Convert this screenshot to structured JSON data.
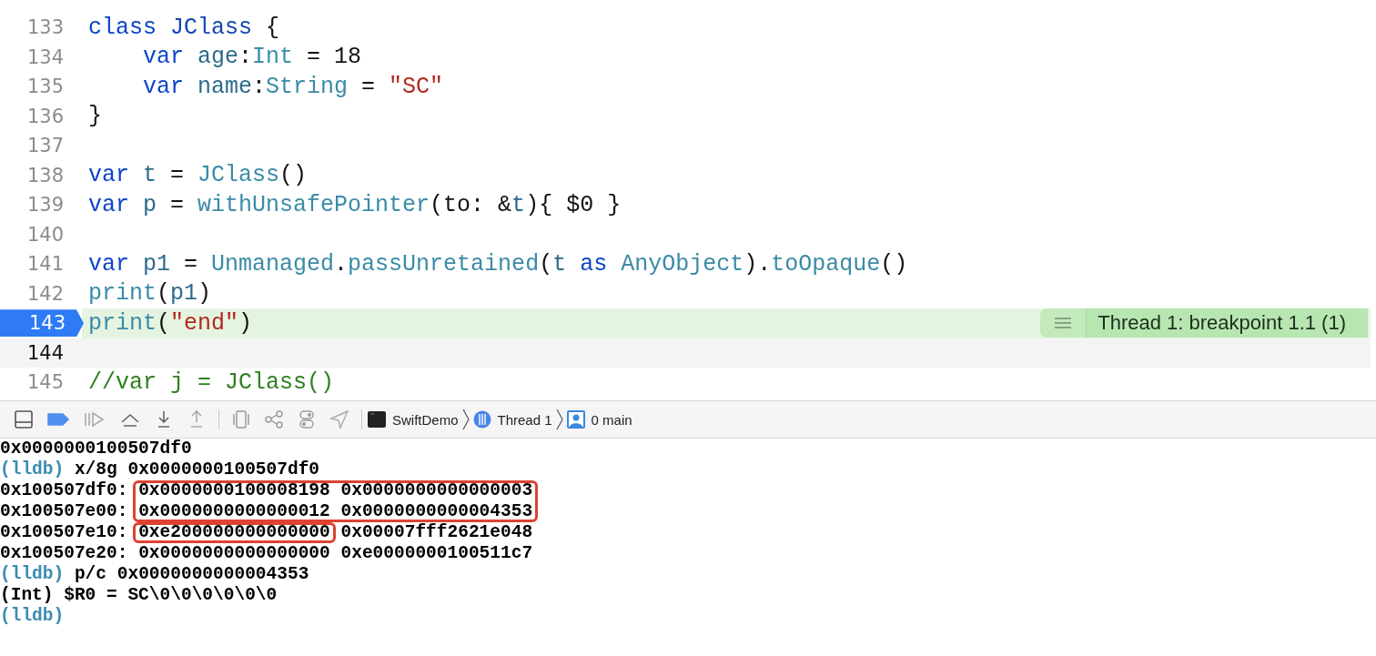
{
  "editor": {
    "lines": [
      {
        "number": "133",
        "current": false,
        "selected": false,
        "tokens": [
          {
            "kind": "kw",
            "text": "class "
          },
          {
            "kind": "decl",
            "text": "JClass"
          },
          {
            "kind": "plain",
            "text": " {"
          }
        ]
      },
      {
        "number": "134",
        "current": false,
        "selected": false,
        "tokens": [
          {
            "kind": "kw",
            "text": "    var "
          },
          {
            "kind": "ident",
            "text": "age"
          },
          {
            "kind": "plain",
            "text": ":"
          },
          {
            "kind": "type",
            "text": "Int"
          },
          {
            "kind": "plain",
            "text": " = "
          },
          {
            "kind": "num",
            "text": "18"
          }
        ]
      },
      {
        "number": "135",
        "current": false,
        "selected": false,
        "tokens": [
          {
            "kind": "kw",
            "text": "    var "
          },
          {
            "kind": "ident",
            "text": "name"
          },
          {
            "kind": "plain",
            "text": ":"
          },
          {
            "kind": "type",
            "text": "String"
          },
          {
            "kind": "plain",
            "text": " = "
          },
          {
            "kind": "str",
            "text": "\"SC\""
          }
        ]
      },
      {
        "number": "136",
        "current": false,
        "selected": false,
        "tokens": [
          {
            "kind": "plain",
            "text": "}"
          }
        ]
      },
      {
        "number": "137",
        "current": false,
        "selected": false
      },
      {
        "number": "138",
        "current": false,
        "selected": false,
        "tokens": [
          {
            "kind": "kw",
            "text": "var "
          },
          {
            "kind": "ident",
            "text": "t"
          },
          {
            "kind": "plain",
            "text": " = "
          },
          {
            "kind": "type",
            "text": "JClass"
          },
          {
            "kind": "plain",
            "text": "()"
          }
        ]
      },
      {
        "number": "139",
        "current": false,
        "selected": false,
        "tokens": [
          {
            "kind": "kw",
            "text": "var "
          },
          {
            "kind": "ident",
            "text": "p"
          },
          {
            "kind": "plain",
            "text": " = "
          },
          {
            "kind": "type",
            "text": "withUnsafePointer"
          },
          {
            "kind": "plain",
            "text": "(to: &"
          },
          {
            "kind": "ident",
            "text": "t"
          },
          {
            "kind": "plain",
            "text": "){ $0 }"
          }
        ]
      },
      {
        "number": "140",
        "current": false,
        "selected": false
      },
      {
        "number": "141",
        "current": false,
        "selected": false,
        "tokens": [
          {
            "kind": "kw",
            "text": "var "
          },
          {
            "kind": "ident",
            "text": "p1"
          },
          {
            "kind": "plain",
            "text": " = "
          },
          {
            "kind": "type",
            "text": "Unmanaged"
          },
          {
            "kind": "plain",
            "text": "."
          },
          {
            "kind": "type",
            "text": "passUnretained"
          },
          {
            "kind": "plain",
            "text": "("
          },
          {
            "kind": "ident",
            "text": "t "
          },
          {
            "kind": "kw",
            "text": "as "
          },
          {
            "kind": "type",
            "text": "AnyObject"
          },
          {
            "kind": "plain",
            "text": ")."
          },
          {
            "kind": "type",
            "text": "toOpaque"
          },
          {
            "kind": "plain",
            "text": "()"
          }
        ]
      },
      {
        "number": "142",
        "current": false,
        "selected": false,
        "tokens": [
          {
            "kind": "type",
            "text": "print"
          },
          {
            "kind": "plain",
            "text": "("
          },
          {
            "kind": "ident",
            "text": "p1"
          },
          {
            "kind": "plain",
            "text": ")"
          }
        ]
      },
      {
        "number": "143",
        "current": true,
        "selected": false,
        "annotation": "Thread 1: breakpoint 1.1 (1)",
        "tokens": [
          {
            "kind": "type",
            "text": "print"
          },
          {
            "kind": "plain",
            "text": "("
          },
          {
            "kind": "str",
            "text": "\"end\""
          },
          {
            "kind": "plain",
            "text": ")"
          }
        ]
      },
      {
        "number": "144",
        "current": false,
        "selected": true
      },
      {
        "number": "145",
        "current": false,
        "selected": false,
        "tokens": [
          {
            "kind": "comment",
            "text": "//var j = JClass()"
          }
        ]
      }
    ]
  },
  "debug_bar": {
    "breakpoints_active": true,
    "tools": [
      {
        "kind": "console-toggle"
      },
      {
        "kind": "breakpoints"
      },
      {
        "kind": "continue"
      },
      {
        "kind": "step-over"
      },
      {
        "kind": "step-in"
      },
      {
        "kind": "step-out"
      },
      {
        "kind": "divider"
      },
      {
        "kind": "view-debugger"
      },
      {
        "kind": "memory-graph"
      },
      {
        "kind": "environment"
      },
      {
        "kind": "location"
      },
      {
        "kind": "divider"
      }
    ],
    "breadcrumbs": [
      {
        "kind": "process",
        "label": "SwiftDemo"
      },
      {
        "kind": "thread",
        "label": "Thread 1"
      },
      {
        "kind": "frame",
        "label": "0 main"
      }
    ]
  },
  "console": {
    "lines": [
      {
        "kind": "output",
        "text": "0x0000000100507df0"
      },
      {
        "kind": "command",
        "prompt": "(lldb)",
        "text": "x/8g 0x0000000100507df0"
      },
      {
        "kind": "memory",
        "address": "0x100507df0:",
        "values": [
          {
            "text": "0x0000000100008198",
            "boxed": true
          },
          {
            "text": "0x0000000000000003",
            "boxed": true
          }
        ]
      },
      {
        "kind": "memory",
        "address": "0x100507e00:",
        "values": [
          {
            "text": "0x0000000000000012",
            "boxed": true
          },
          {
            "text": "0x0000000000004353",
            "boxed": true
          }
        ]
      },
      {
        "kind": "memory",
        "address": "0x100507e10:",
        "values": [
          {
            "text": "0xe200000000000000",
            "boxed": true
          },
          {
            "text": "0x00007fff2621e048",
            "boxed": false
          }
        ]
      },
      {
        "kind": "memory",
        "address": "0x100507e20:",
        "values": [
          {
            "text": "0x0000000000000000",
            "boxed": false
          },
          {
            "text": "0xe0000000100511c7",
            "boxed": false
          }
        ]
      },
      {
        "kind": "command",
        "prompt": "(lldb)",
        "text": "p/c 0x0000000000004353"
      },
      {
        "kind": "output",
        "text": "(Int) $R0 = SC\\0\\0\\0\\0\\0\\0"
      },
      {
        "kind": "command",
        "prompt": "(lldb)"
      }
    ]
  }
}
